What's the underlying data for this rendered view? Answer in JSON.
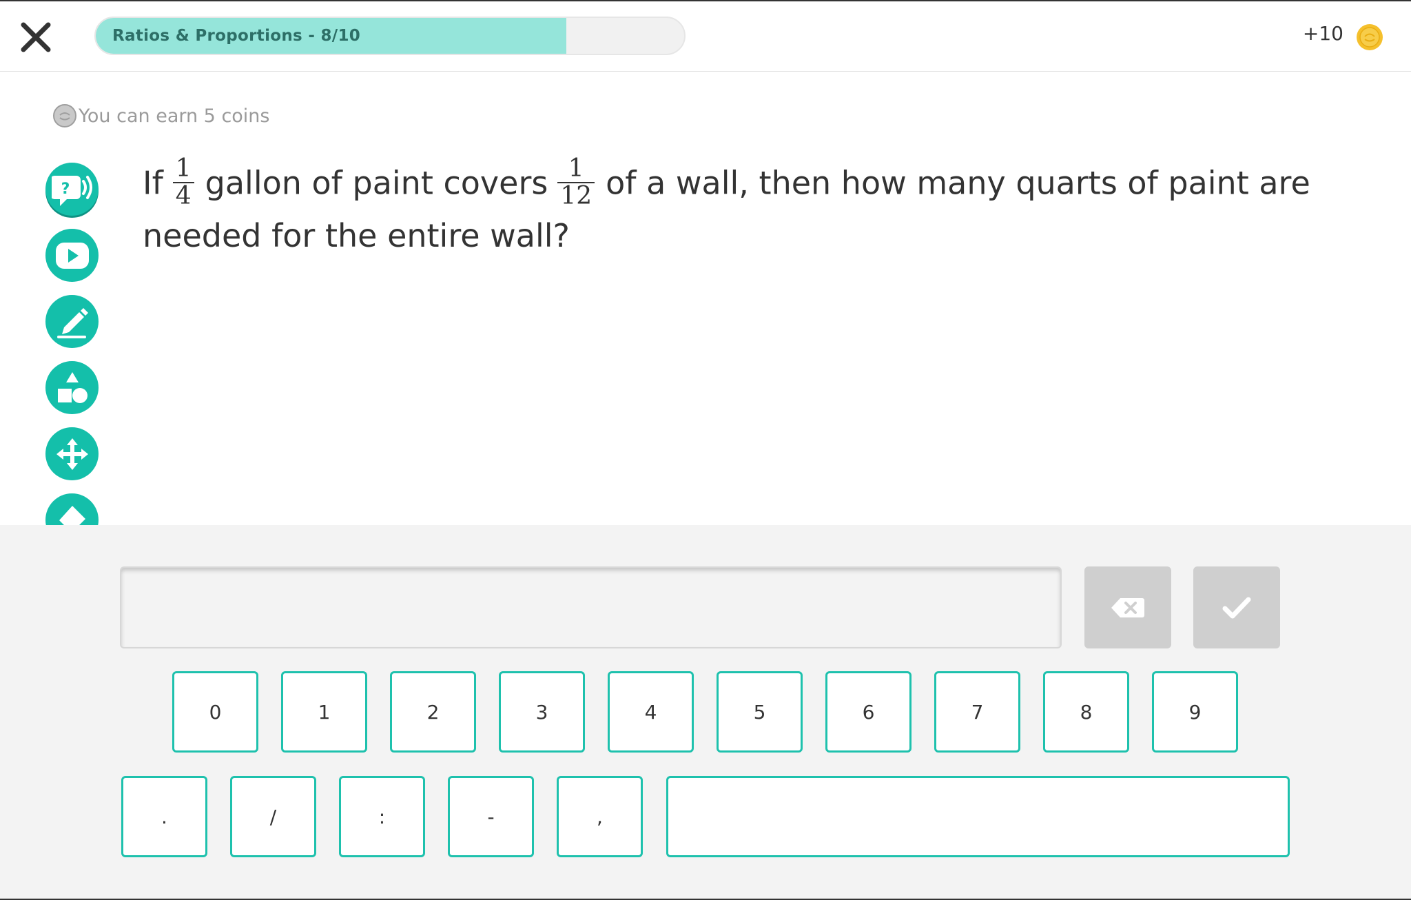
{
  "header": {
    "progress_label": "Ratios & Proportions - 8/10",
    "progress_fraction": 0.8,
    "score": "+10"
  },
  "question": {
    "earn_text": "You can earn 5 coins",
    "part1": "If",
    "frac1_num": "1",
    "frac1_den": "4",
    "part2": "gallon of paint covers",
    "frac2_num": "1",
    "frac2_den": "12",
    "part3": "of a wall, then how many quarts of paint are needed for the entire wall?"
  },
  "tools": [
    {
      "name": "audio-help-icon"
    },
    {
      "name": "video-play-icon"
    },
    {
      "name": "pencil-icon"
    },
    {
      "name": "shapes-icon"
    },
    {
      "name": "move-arrows-icon"
    },
    {
      "name": "eraser-icon"
    }
  ],
  "keyboard": {
    "answer_value": "",
    "row1": [
      "0",
      "1",
      "2",
      "3",
      "4",
      "5",
      "6",
      "7",
      "8",
      "9"
    ],
    "row2": [
      ".",
      "/",
      ":",
      "-",
      ","
    ]
  },
  "colors": {
    "accent": "#14bfaa",
    "progress_fill": "#95e5da",
    "key_border": "#1ec1ad",
    "coin": "#f5c02c",
    "disabled_button": "#cfcfcf"
  }
}
